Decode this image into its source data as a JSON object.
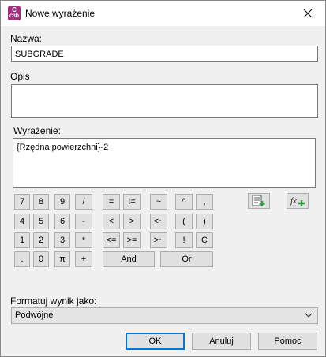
{
  "window": {
    "title": "Nowe wyrażenie",
    "icon_letter": "C",
    "icon_sub": "C3D"
  },
  "name": {
    "label": "Nazwa:",
    "value": "SUBGRADE"
  },
  "description": {
    "label": "Opis",
    "value": ""
  },
  "expression": {
    "label": "Wyrażenie:",
    "value": "{Rzędna powierzchni}-2"
  },
  "keypad": {
    "row1": [
      "7",
      "8",
      "9",
      "/",
      "=",
      "!=",
      "~",
      "^",
      ","
    ],
    "row2": [
      "4",
      "5",
      "6",
      "-",
      "<",
      ">",
      "<~",
      "(",
      ")"
    ],
    "row3": [
      "1",
      "2",
      "3",
      "*",
      "<=",
      ">=",
      ">~",
      "!",
      "C"
    ],
    "row4": [
      ".",
      "0",
      "π",
      "+"
    ],
    "and_label": "And",
    "or_label": "Or"
  },
  "icons": {
    "insert_property": "insert-property-icon",
    "insert_function": "insert-function-icon"
  },
  "format": {
    "label": "Formatuj wynik jako:",
    "selected": "Podwójne"
  },
  "buttons": {
    "ok": "OK",
    "cancel": "Anuluj",
    "help": "Pomoc"
  },
  "colors": {
    "app_icon": "#a0307e",
    "default_button_border": "#0078d7",
    "icon_green": "#2f9e44"
  }
}
